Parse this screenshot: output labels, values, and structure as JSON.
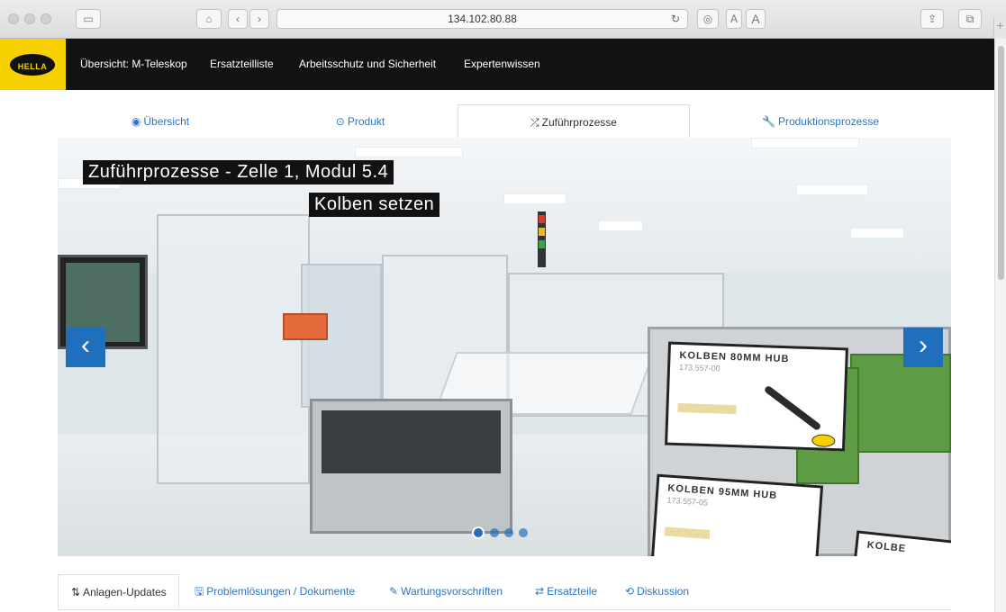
{
  "browser": {
    "url": "134.102.80.88",
    "home_icon": "home-icon",
    "reader_label_small": "A",
    "reader_label_large": "A",
    "new_tab_label": "+"
  },
  "nav": {
    "logo_text": "HELLA",
    "items": [
      {
        "label": "Übersicht: M-Teleskop"
      },
      {
        "label": "Ersatzteilliste"
      },
      {
        "label": "Arbeitsschutz und Sicherheit"
      },
      {
        "label": "Expertenwissen"
      }
    ]
  },
  "tabs": [
    {
      "label": "Übersicht",
      "icon": "eye-icon",
      "glyph": "◉"
    },
    {
      "label": "Produkt",
      "icon": "target-icon",
      "glyph": "⊙"
    },
    {
      "label": "Zuführprozesse",
      "icon": "shuffle-icon",
      "glyph": "⤮",
      "active": true
    },
    {
      "label": "Produktionsprozesse",
      "icon": "wrench-icon",
      "glyph": "🔧"
    }
  ],
  "carousel": {
    "caption_title": "Zuführprozesse - Zelle 1, Modul 5.4",
    "caption_sub": "Kolben setzen",
    "prev_label": "‹",
    "next_label": "›",
    "card1": {
      "title": "KOLBEN 80MM HUB",
      "sub": "173.557-00"
    },
    "card2": {
      "title": "KOLBEN 95MM HUB",
      "sub": "173.557-05"
    },
    "card3": {
      "title": "KOLBE"
    },
    "slide_count": 4,
    "active_slide": 1
  },
  "bottom_tabs": [
    {
      "label": "Anlagen-Updates",
      "icon": "sort-icon",
      "glyph": "⇅",
      "active": true
    },
    {
      "label": "Problemlösungen / Dokumente",
      "icon": "save-icon",
      "glyph": "🖫"
    },
    {
      "label": "Wartungsvorschriften",
      "icon": "pencil-icon",
      "glyph": "✎"
    },
    {
      "label": "Ersatzteile",
      "icon": "exchange-icon",
      "glyph": "⇄"
    },
    {
      "label": "Diskussion",
      "icon": "retweet-icon",
      "glyph": "⟲"
    }
  ],
  "colors": {
    "brand": "#f7d000",
    "nav_bg": "#121212",
    "link": "#2a74c9",
    "arrow_bg": "#1f6fbd"
  }
}
